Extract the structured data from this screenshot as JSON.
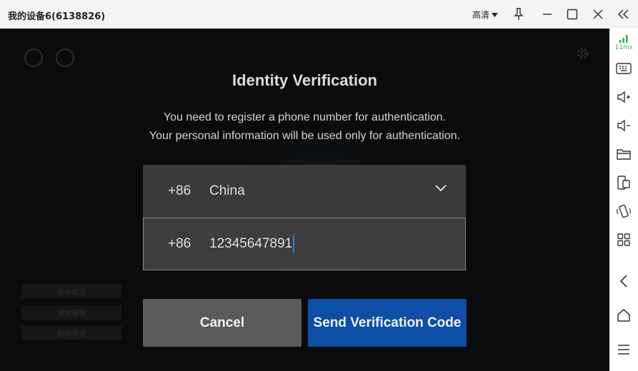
{
  "window": {
    "title": "我的设备6(6138826)",
    "quality_label": "高清"
  },
  "side_panel": {
    "ping": "11ms",
    "accent": "#2cb35a"
  },
  "background": {
    "menu_items": [
      "安全設定",
      "連號管理",
      "刪除帳號"
    ]
  },
  "dialog": {
    "title": "Identity Verification",
    "description_line1": "You need to register a phone number for authentication.",
    "description_line2": "Your personal information will be used only for authentication.",
    "country_code": "+86",
    "country_name": "China",
    "phone_code": "+86",
    "phone_value": "12345647891",
    "cancel_label": "Cancel",
    "send_label": "Send Verification Code",
    "send_color": "#0d4fa6"
  }
}
